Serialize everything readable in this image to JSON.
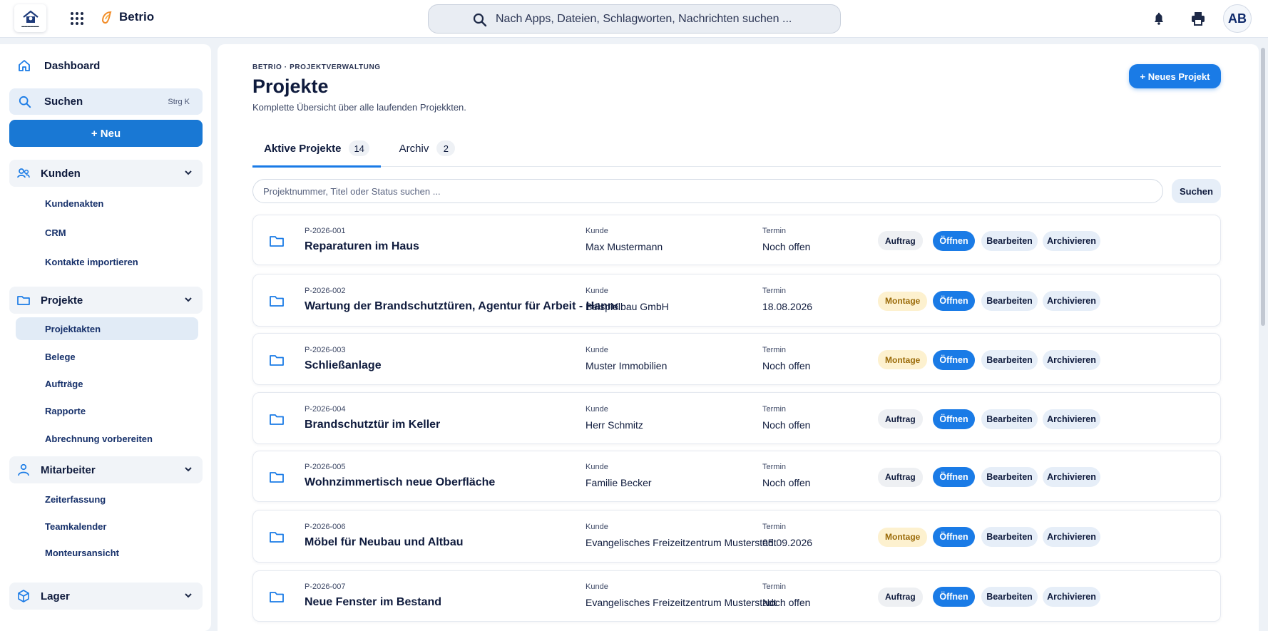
{
  "topbar": {
    "brand": "Betrio",
    "search_placeholder": "Nach Apps, Dateien, Schlagworten, Nachrichten suchen ...",
    "avatar_initials": "AB",
    "icons": [
      "apps-grid-icon",
      "bell-icon",
      "printer-icon"
    ]
  },
  "sidebar": {
    "dashboard": "Dashboard",
    "search": {
      "label": "Suchen",
      "shortcut": "Strg K"
    },
    "new_button": "+ Neu",
    "groups": [
      {
        "label": "Kunden",
        "icon": "users-icon",
        "items": [
          "Kundenakten",
          "CRM",
          "Kontakte importieren"
        ]
      },
      {
        "label": "Projekte",
        "icon": "folder-icon",
        "items": [
          "Projektakten",
          "Belege",
          "Aufträge",
          "Rapporte",
          "Abrechnung vorbereiten"
        ],
        "active": "Projektakten"
      },
      {
        "label": "Mitarbeiter",
        "icon": "person-icon",
        "items": [
          "Zeiterfassung",
          "Teamkalender",
          "Monteursansicht"
        ]
      },
      {
        "label": "Lager",
        "icon": "box-icon",
        "items": []
      }
    ]
  },
  "main": {
    "breadcrumb": "BETRIO · PROJEKTVERWALTUNG",
    "title": "Projekte",
    "subtitle": "Komplette Übersicht über alle laufenden Projekkten.",
    "new_project_button": "+ Neues Projekt",
    "tabs": [
      {
        "label": "Aktive Projekte",
        "count": "14",
        "active": true
      },
      {
        "label": "Archiv",
        "count": "2",
        "active": false
      }
    ],
    "filter": {
      "placeholder": "Projektnummer, Titel oder Status suchen ...",
      "button": "Suchen"
    },
    "column_labels": {
      "customer": "Kunde",
      "date": "Termin"
    },
    "actions": {
      "open": "Öffnen",
      "edit": "Bearbeiten",
      "archive": "Archivieren"
    },
    "status_colors": {
      "Auftrag": "#eef0f3",
      "Montage": "#fdf1cf"
    },
    "projects": [
      {
        "number": "P-2026-001",
        "title": "Reparaturen im Haus",
        "customer": "Max Mustermann",
        "date": "Noch offen",
        "status": "Auftrag"
      },
      {
        "number": "P-2026-002",
        "title": "Wartung der Brandschutztüren, Agentur für Arbeit - Hannover",
        "customer": "Beispielbau GmbH",
        "date": "18.08.2026",
        "status": "Montage"
      },
      {
        "number": "P-2026-003",
        "title": "Schließanlage",
        "customer": "Muster Immobilien",
        "date": "Noch offen",
        "status": "Montage"
      },
      {
        "number": "P-2026-004",
        "title": "Brandschutztür im Keller",
        "customer": "Herr Schmitz",
        "date": "Noch offen",
        "status": "Auftrag"
      },
      {
        "number": "P-2026-005",
        "title": "Wohnzimmertisch neue Oberfläche",
        "customer": "Familie Becker",
        "date": "Noch offen",
        "status": "Auftrag"
      },
      {
        "number": "P-2026-006",
        "title": "Möbel für Neubau und Altbau",
        "customer": "Evangelisches Freizeitzentrum Musterstadt",
        "date": "05.09.2026",
        "status": "Montage"
      },
      {
        "number": "P-2026-007",
        "title": "Neue Fenster im Bestand",
        "customer": "Evangelisches Freizeitzentrum Musterstadt",
        "date": "Noch offen",
        "status": "Auftrag"
      }
    ]
  },
  "colors": {
    "accent": "#1a7be6",
    "sidebar_new": "#1978d4",
    "text": "#0f1b3d"
  }
}
